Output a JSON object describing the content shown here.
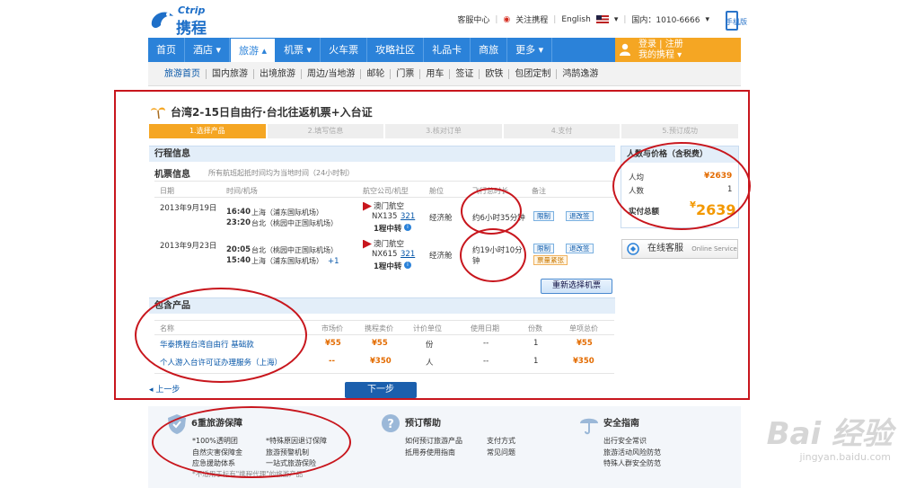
{
  "header": {
    "logo_en": "Ctrip",
    "logo_cn": "携程",
    "links": [
      "客服中心",
      "关注携程",
      "English"
    ],
    "phone": "国内：1010-6666",
    "mobile": "手机版"
  },
  "nav": {
    "items": [
      "首页",
      "酒店 ▾",
      "旅游 ▴",
      "机票 ▾",
      "火车票",
      "攻略社区",
      "礼品卡",
      "商旅",
      "更多 ▾"
    ],
    "login": "登录 | 注册",
    "my_ctrip": "我的携程 ▾"
  },
  "subnav": [
    "旅游首页",
    "国内旅游",
    "出境旅游",
    "周边/当地游",
    "邮轮",
    "门票",
    "用车",
    "签证",
    "欧铁",
    "包团定制",
    "鸿鹄逸游"
  ],
  "product": {
    "title": "台湾2-15日自由行·台北往返机票+入台证"
  },
  "steps": [
    "1.选择产品",
    "2.填写信息",
    "3.核对订单",
    "4.支付",
    "5.预订成功"
  ],
  "itinerary": {
    "header": "行程信息",
    "flight_title": "机票信息",
    "flight_note": "所有航班起抵时间均为当地时间（24小时制）",
    "columns": [
      "日期",
      "时间/机场",
      "航空公司/机型",
      "舱位",
      "飞行总时长",
      "备注"
    ],
    "flights": [
      {
        "date": "2013年9月19日",
        "dep_time": "16:40",
        "dep_airport": "上海（浦东国际机场）",
        "arr_time": "23:20",
        "arr_airport": "台北（桃园中正国际机场）",
        "airline": "澳门航空",
        "flight_no": "NX135",
        "aircraft": "321",
        "transfer": "1程中转",
        "cabin": "经济舱",
        "duration": "约6小时35分钟",
        "btn1": "限制",
        "btn2": "退改签"
      },
      {
        "date": "2013年9月23日",
        "dep_time": "20:05",
        "dep_airport": "台北（桃园中正国际机场）",
        "arr_time": "15:40",
        "arr_airport": "上海（浦东国际机场）",
        "next_day": "+1",
        "airline": "澳门航空",
        "flight_no": "NX615",
        "aircraft": "321",
        "transfer": "1程中转",
        "cabin": "经济舱",
        "duration_a": "约19小时10分",
        "duration_b": "钟",
        "btn1": "限制",
        "btn2": "退改签",
        "btn3": "票量紧张"
      }
    ],
    "reselect": "重新选择机票"
  },
  "package": {
    "header": "包含产品",
    "columns": [
      "名称",
      "市场价",
      "携程卖价",
      "计价单位",
      "使用日期",
      "份数",
      "单项总价"
    ],
    "rows": [
      {
        "name": "华泰携程台湾自由行 基础款",
        "market": "¥55",
        "price": "¥55",
        "unit": "份",
        "date": "--",
        "qty": "1",
        "total": "¥55"
      },
      {
        "name": "个人游入台许可证办理服务（上海）",
        "market": "--",
        "price": "¥350",
        "unit": "人",
        "date": "--",
        "qty": "1",
        "total": "¥350"
      }
    ]
  },
  "nav_buttons": {
    "prev": "上一步",
    "next": "下一步"
  },
  "price_box": {
    "header": "人数与价格（含税费）",
    "per_person_label": "人均",
    "per_person": "¥2639",
    "count_label": "人数",
    "count": "1",
    "total_label": "实付总额",
    "total_symbol": "¥",
    "total": "2639"
  },
  "online_service": {
    "label": "在线客服",
    "en": "Online Service"
  },
  "footer": {
    "guarantee": {
      "title": "6重旅游保障",
      "items": [
        "*100%透明团",
        "*特殊原因退订保障",
        "自然灾害保障金",
        "旅游预警机制",
        "应急援助体系",
        "一站式旅游保险"
      ],
      "note": "*不适用于标有\"携程代理\"的旅游产品"
    },
    "help": {
      "title": "预订帮助",
      "items": [
        "如何预订旅游产品",
        "支付方式",
        "抵用券使用指南",
        "常见问题"
      ]
    },
    "safety": {
      "title": "安全指南",
      "items": [
        "出行安全常识",
        "旅游活动风险防范",
        "特殊人群安全防范"
      ]
    }
  },
  "watermark": {
    "main": "Bai 经验",
    "sub": "jingyan.baidu.com"
  },
  "colors": {
    "brand_blue": "#2b82d9",
    "orange": "#f5a623",
    "annotation_red": "#c8161d",
    "price_orange": "#e36b00"
  }
}
